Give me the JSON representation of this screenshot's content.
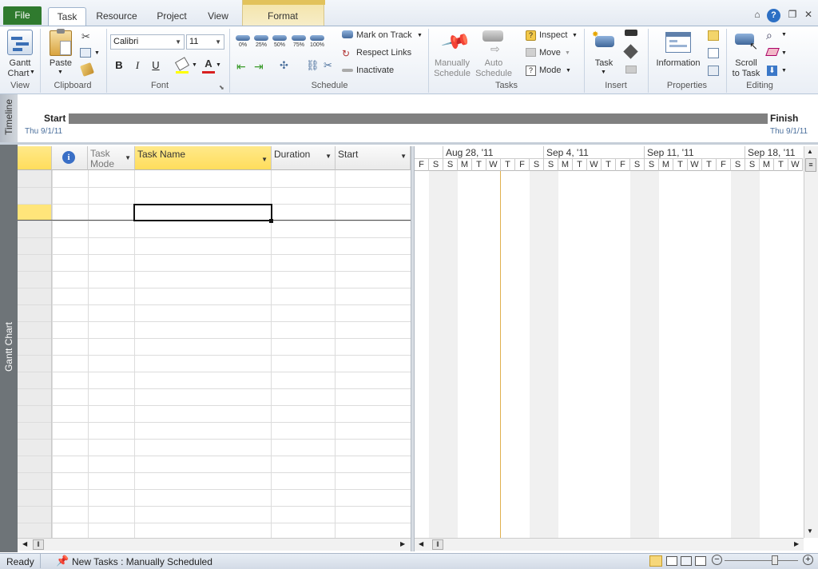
{
  "tabs": {
    "file": "File",
    "task": "Task",
    "resource": "Resource",
    "project": "Project",
    "view": "View",
    "format": "Format"
  },
  "ribbon": {
    "view": {
      "gantt_chart": "Gantt",
      "gantt_chart2": "Chart",
      "label": "View"
    },
    "clipboard": {
      "paste": "Paste",
      "label": "Clipboard"
    },
    "font": {
      "family": "Calibri",
      "size": "11",
      "bold": "B",
      "italic": "I",
      "underline": "U",
      "font_color": "A",
      "label": "Font"
    },
    "schedule": {
      "pcts": [
        "0%",
        "25%",
        "50%",
        "75%",
        "100%"
      ],
      "mark_on_track": "Mark on Track",
      "respect_links": "Respect Links",
      "inactivate": "Inactivate",
      "label": "Schedule"
    },
    "tasks": {
      "manually": "Manually",
      "manually2": "Schedule",
      "auto": "Auto",
      "auto2": "Schedule",
      "inspect": "Inspect",
      "move": "Move",
      "mode": "Mode",
      "label": "Tasks"
    },
    "insert": {
      "task": "Task",
      "label": "Insert"
    },
    "properties": {
      "information": "Information",
      "label": "Properties"
    },
    "editing": {
      "scroll": "Scroll",
      "scroll2": "to Task",
      "label": "Editing"
    }
  },
  "timeline": {
    "side_label": "Timeline",
    "start_label": "Start",
    "start_date": "Thu 9/1/11",
    "finish_label": "Finish",
    "finish_date": "Thu 9/1/11"
  },
  "view_side_label": "Gantt Chart",
  "grid": {
    "columns": {
      "info": "i",
      "task_mode_1": "Task",
      "task_mode_2": "Mode",
      "task_name": "Task Name",
      "duration": "Duration",
      "start": "Start"
    }
  },
  "gantt": {
    "weeks": [
      "Aug 28, '11",
      "Sep 4, '11",
      "Sep 11, '11",
      "Sep 18, '11"
    ],
    "days": [
      "F",
      "S",
      "S",
      "M",
      "T",
      "W",
      "T",
      "F",
      "S",
      "S",
      "M",
      "T",
      "W",
      "T",
      "F",
      "S",
      "S",
      "M",
      "T",
      "W",
      "T",
      "F",
      "S",
      "S",
      "M",
      "T",
      "W"
    ]
  },
  "status": {
    "ready": "Ready",
    "new_tasks": "New Tasks : Manually Scheduled"
  },
  "colors": {
    "file_tab": "#2f7a2e",
    "tools_header": "#e2c25b",
    "selected_header": "#ffe57a",
    "timeline_bar": "#808080",
    "today_line": "#e0b050"
  }
}
